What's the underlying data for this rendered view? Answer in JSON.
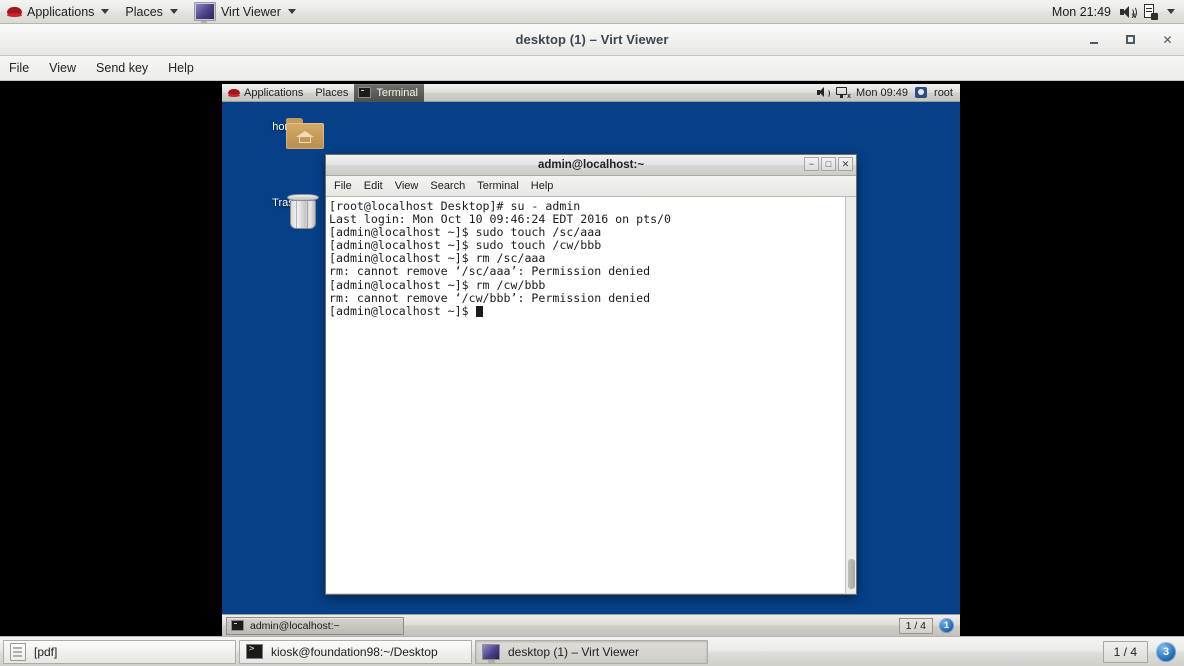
{
  "host_panel": {
    "logo_icon": "redhat-logo-icon",
    "menus": [
      {
        "label": "Applications",
        "icon": "redhat-logo-icon",
        "has_caret": true
      },
      {
        "label": "Places",
        "has_caret": true
      },
      {
        "label": "Virt Viewer",
        "icon": "virt-viewer-icon",
        "has_caret": true
      }
    ],
    "clock": "Mon 21:49",
    "volume_icon": "speaker-muted-icon",
    "notification_icon": "document-badge-icon"
  },
  "virt_viewer_window": {
    "title": "desktop (1) – Virt Viewer",
    "window_buttons": {
      "minimize": "−",
      "maximize": "□",
      "close": "✕"
    },
    "menubar": [
      "File",
      "View",
      "Send key",
      "Help"
    ]
  },
  "guest": {
    "desktop_background_color": "#064089",
    "panel": {
      "left_items": [
        {
          "label": "Applications",
          "icon": "redhat-logo-icon"
        },
        {
          "label": "Places"
        }
      ],
      "active_task": {
        "label": "Terminal",
        "icon": "terminal-icon"
      },
      "volume_icon": "speaker-icon",
      "network_icon": "network-disconnected-icon",
      "clock": "Mon 09:49",
      "user_icon": "user-icon",
      "user": "root"
    },
    "desktop_icons": [
      {
        "label": "home",
        "icon": "home-folder-icon"
      },
      {
        "label": "Trash",
        "icon": "trash-icon"
      }
    ],
    "terminal": {
      "title": "admin@localhost:~",
      "window_buttons": {
        "minimize": "−",
        "maximize": "□",
        "close": "✕"
      },
      "menubar": [
        "File",
        "Edit",
        "View",
        "Search",
        "Terminal",
        "Help"
      ],
      "lines": [
        "[root@localhost Desktop]# su - admin",
        "Last login: Mon Oct 10 09:46:24 EDT 2016 on pts/0",
        "[admin@localhost ~]$ sudo touch /sc/aaa",
        "[admin@localhost ~]$ sudo touch /cw/bbb",
        "[admin@localhost ~]$ rm /sc/aaa",
        "rm: cannot remove ‘/sc/aaa’: Permission denied",
        "[admin@localhost ~]$ rm /cw/bbb",
        "rm: cannot remove ‘/cw/bbb’: Permission denied"
      ],
      "prompt": "[admin@localhost ~]$ ",
      "cursor": "block"
    },
    "taskbar": {
      "tasks": [
        {
          "label": "admin@localhost:~",
          "icon": "terminal-icon",
          "active": true
        }
      ],
      "workspace_label": "1 / 4",
      "workspace_number": "1"
    }
  },
  "host_taskbar": {
    "tasks": [
      {
        "label": "[pdf]",
        "icon": "pdf-icon",
        "active": false
      },
      {
        "label": "kiosk@foundation98:~/Desktop",
        "icon": "terminal-icon",
        "active": false
      },
      {
        "label": "desktop (1) – Virt Viewer",
        "icon": "virt-viewer-icon",
        "active": true
      }
    ],
    "workspace_label": "1 / 4",
    "workspace_number": "3"
  }
}
